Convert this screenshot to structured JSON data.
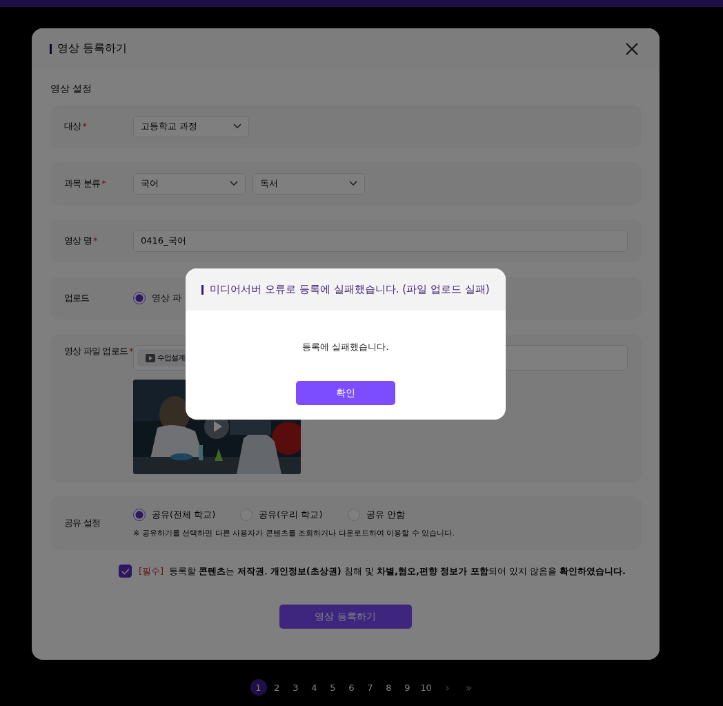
{
  "modal": {
    "title": "영상 등록하기",
    "section_title": "영상 설정"
  },
  "fields": [
    {
      "kind": "select",
      "label": "대상",
      "required_mark": "*",
      "selects": [
        "고등학교 과정"
      ]
    },
    {
      "kind": "select",
      "label": "과목 분류",
      "required_mark": "*",
      "selects": [
        "국어",
        "독서"
      ]
    },
    {
      "kind": "text",
      "label": "영상 명",
      "required_mark": "*",
      "value": "0416_국어"
    },
    {
      "kind": "radio",
      "label": "업로드",
      "options": [
        {
          "label": "영상 파",
          "selected": true
        }
      ]
    },
    {
      "kind": "file",
      "label": "영상 파일 업로드",
      "required_mark": "*",
      "file": "수업설계"
    },
    {
      "kind": "radio",
      "label": "공유 설정",
      "options": [
        {
          "label": "공유(전체 학교)",
          "selected": true
        },
        {
          "label": "공유(우리 학교)",
          "selected": false
        },
        {
          "label": "공유 안함",
          "selected": false
        }
      ],
      "note": "※ 공유하기를 선택하면 다른 사용자가 콘텐츠를 조회하거나 다운로드하여 이용할 수 있습니다."
    }
  ],
  "consent": {
    "checked": true,
    "tag": "[필수]",
    "text": "등록할 **콘텐츠**는 **저작권**, **개인정보(초상권)** 침해 및 **차별,혐오,편향** **정보가 포함**되어 있지 않음을 **확인하였습니다.**"
  },
  "submit": "영상 등록하기",
  "pagination": {
    "pages": [
      {
        "label": "1",
        "selected": true
      },
      {
        "label": "2",
        "selected": false
      },
      {
        "label": "3",
        "selected": false
      },
      {
        "label": "4",
        "selected": false
      },
      {
        "label": "5",
        "selected": false
      },
      {
        "label": "6",
        "selected": false
      },
      {
        "label": "7",
        "selected": false
      },
      {
        "label": "8",
        "selected": false
      },
      {
        "label": "9",
        "selected": false
      },
      {
        "label": "10",
        "selected": false
      }
    ],
    "next": "›",
    "last": "»"
  },
  "alert": {
    "title": "미디어서버 오류로 등록에 실패했습니다. (파일 업로드 실패)",
    "message": "등록에 실패했습니다.",
    "confirm": "확인"
  }
}
